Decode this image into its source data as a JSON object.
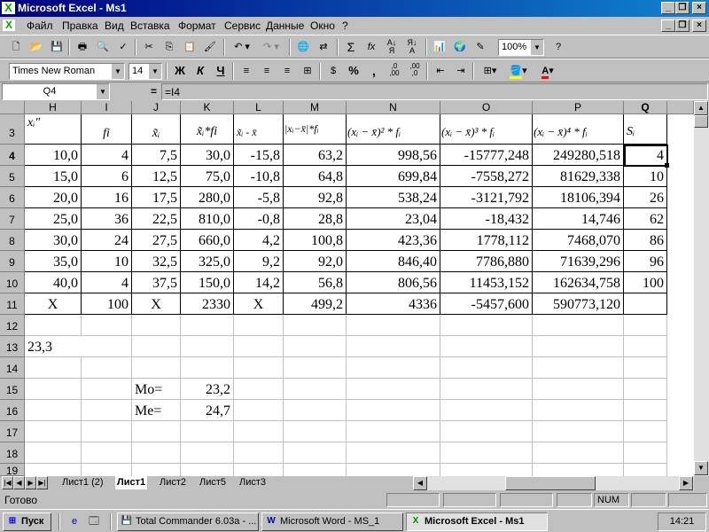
{
  "window": {
    "title": "Microsoft Excel - Ms1",
    "minimize": "_",
    "maximize": "❐",
    "close": "×"
  },
  "menu": [
    "Файл",
    "Правка",
    "Вид",
    "Вставка",
    "Формат",
    "Сервис",
    "Данные",
    "Окно",
    "?"
  ],
  "toolbar": {
    "zoom": "100%",
    "font": "Times New Roman",
    "size": "14",
    "bold": "Ж",
    "italic": "К",
    "underline": "Ч",
    "percent": "%",
    "comma": ",",
    "inc_dec": ",0\n,00",
    "dec_dec": ",00\n,0",
    "sum": "Σ",
    "fx": "fx",
    "font_color_label": "A"
  },
  "formula_bar": {
    "name_box": "Q4",
    "equals": "=",
    "formula": "=I4"
  },
  "grid": {
    "columns": [
      "H",
      "I",
      "J",
      "K",
      "L",
      "M",
      "N",
      "O",
      "P",
      "Q"
    ],
    "rows": [
      "3",
      "4",
      "5",
      "6",
      "7",
      "8",
      "9",
      "10",
      "11",
      "12",
      "13",
      "14",
      "15",
      "16",
      "17",
      "18",
      "19"
    ],
    "header_row": [
      "xᵢ″",
      "fi",
      "x̃ᵢ",
      "x̃ᵢ*fi",
      "x̃ᵢ - x̄",
      "|xᵢ−x̄|*fᵢ",
      "(xᵢ − x̄)² * fᵢ",
      "(xᵢ − x̄)³ * fᵢ",
      "(xᵢ − x̄)⁴ * fᵢ",
      "Sᵢ"
    ],
    "data": [
      [
        "10,0",
        "4",
        "7,5",
        "30,0",
        "-15,8",
        "63,2",
        "998,56",
        "-15777,248",
        "249280,518",
        "4"
      ],
      [
        "15,0",
        "6",
        "12,5",
        "75,0",
        "-10,8",
        "64,8",
        "699,84",
        "-7558,272",
        "81629,338",
        "10"
      ],
      [
        "20,0",
        "16",
        "17,5",
        "280,0",
        "-5,8",
        "92,8",
        "538,24",
        "-3121,792",
        "18106,394",
        "26"
      ],
      [
        "25,0",
        "36",
        "22,5",
        "810,0",
        "-0,8",
        "28,8",
        "23,04",
        "-18,432",
        "14,746",
        "62"
      ],
      [
        "30,0",
        "24",
        "27,5",
        "660,0",
        "4,2",
        "100,8",
        "423,36",
        "1778,112",
        "7468,070",
        "86"
      ],
      [
        "35,0",
        "10",
        "32,5",
        "325,0",
        "9,2",
        "92,0",
        "846,40",
        "7786,880",
        "71639,296",
        "96"
      ],
      [
        "40,0",
        "4",
        "37,5",
        "150,0",
        "14,2",
        "56,8",
        "806,56",
        "11453,152",
        "162634,758",
        "100"
      ],
      [
        "X",
        "100",
        "X",
        "2330",
        "X",
        "499,2",
        "4336",
        "-5457,600",
        "590773,120",
        ""
      ]
    ],
    "h13": "23,3",
    "mo_label": "Mo=",
    "mo_value": "23,2",
    "me_label": "Me=",
    "me_value": "24,7"
  },
  "sheets": [
    "Лист1 (2)",
    "Лист1",
    "Лист2",
    "Лист5",
    "Лист3"
  ],
  "status": {
    "ready": "Готово",
    "num": "NUM"
  },
  "taskbar": {
    "start": "Пуск",
    "tasks": [
      "Total Commander 6.03a - ...",
      "Microsoft Word - MS_1",
      "Microsoft Excel - Ms1"
    ],
    "clock": "14:21"
  }
}
